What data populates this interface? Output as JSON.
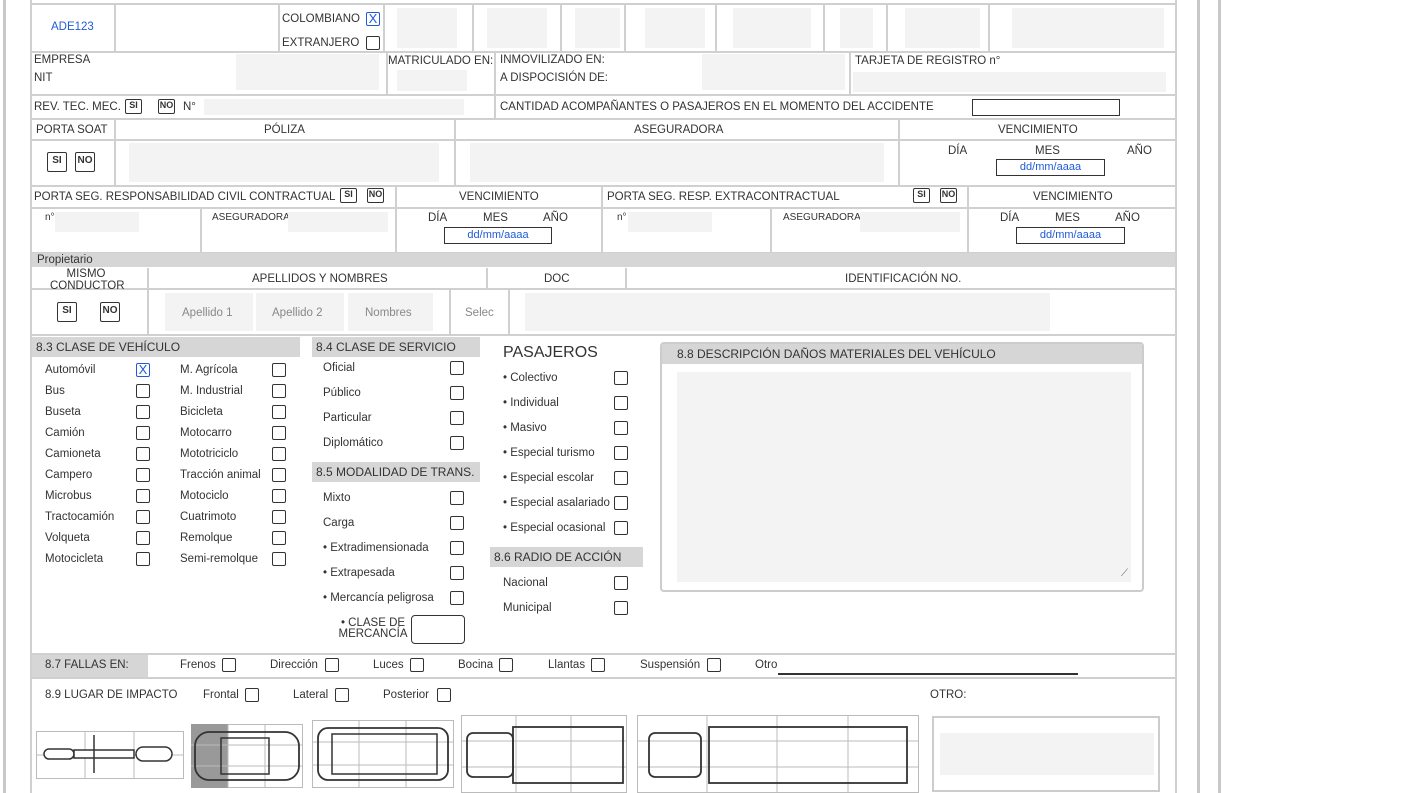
{
  "vehicle": {
    "plate": "ADE123",
    "colombiano": "COLOMBIANO",
    "extranjero": "EXTRANJERO",
    "mark": "X"
  },
  "row2": {
    "empresa": "EMPRESA",
    "nit": "NIT",
    "matriculado": "MATRICULADO EN:",
    "inmovilizado": "INMOVILIZADO EN:",
    "disposicion": "A DISPOCISIÓN DE:",
    "tarjeta": "TARJETA DE REGISTRO n°"
  },
  "row3": {
    "revtec": "REV. TEC. MEC.",
    "si": "SI",
    "no": "NO",
    "num": "N°",
    "acomp": "CANTIDAD ACOMPAÑANTES O PASAJEROS EN EL MOMENTO DEL ACCIDENTE"
  },
  "soat": {
    "porta": "PORTA SOAT",
    "poliza": "PÓLIZA",
    "aseguradora": "ASEGURADORA",
    "vencimiento": "VENCIMIENTO",
    "dia": "DÍA",
    "mes": "MES",
    "anio": "AÑO",
    "date_placeholder": "dd/mm/aaaa"
  },
  "rc": {
    "contractual": "PORTA SEG. RESPONSABILIDAD CIVIL CONTRACTUAL",
    "vencimiento": "VENCIMIENTO",
    "extra": "PORTA SEG. RESP. EXTRACONTRACTUAL",
    "n": "n°",
    "aseguradora": "ASEGURADORA"
  },
  "owner": {
    "title": "Propietario",
    "mismo": "MISMO CONDUCTOR",
    "apellidos": "APELLIDOS Y NOMBRES",
    "doc": "DOC",
    "ident": "IDENTIFICACIÓN NO.",
    "ap1": "Apellido 1",
    "ap2": "Apellido 2",
    "nombres": "Nombres",
    "select": "Selec"
  },
  "clase": {
    "title": "8.3 CLASE DE VEHÍCULO",
    "col1": [
      "Automóvil",
      "Bus",
      "Buseta",
      "Camión",
      "Camioneta",
      "Campero",
      "Microbus",
      "Tractocamión",
      "Volqueta",
      "Motocicleta"
    ],
    "col2": [
      "M. Agrícola",
      "M. Industrial",
      "Bicicleta",
      "Motocarro",
      "Mototriciclo",
      "Tracción animal",
      "Motociclo",
      "Cuatrimoto",
      "Remolque",
      "Semi-remolque"
    ],
    "checked_mark": "X"
  },
  "servicio": {
    "title": "8.4 CLASE DE SERVICIO",
    "items": [
      "Oficial",
      "Público",
      "Particular",
      "Diplomático"
    ]
  },
  "modalidad": {
    "title": "8.5 MODALIDAD DE TRANS.",
    "items": [
      "Mixto",
      "Carga",
      "• Extradimensionada",
      "• Extrapesada",
      "• Mercancía peligrosa"
    ],
    "clase_merc": "• CLASE DE MERCANCÍA"
  },
  "pasajeros": {
    "title": "PASAJEROS",
    "items": [
      "• Colectivo",
      "• Individual",
      "• Masivo",
      "• Especial turismo",
      "• Especial escolar",
      "• Especial asalariado",
      "• Especial ocasional"
    ]
  },
  "radio": {
    "title": "8.6 RADIO DE ACCIÓN",
    "items": [
      "Nacional",
      "Municipal"
    ]
  },
  "danos": {
    "title": "8.8 DESCRIPCIÓN DAÑOS MATERIALES DEL VEHÍCULO"
  },
  "fallas": {
    "title": "8.7 FALLAS EN:",
    "items": [
      "Frenos",
      "Dirección",
      "Luces",
      "Bocina",
      "Llantas",
      "Suspensión"
    ],
    "otro": "Otro"
  },
  "impacto": {
    "title": "8.9 LUGAR DE IMPACTO",
    "items": [
      "Frontal",
      "Lateral",
      "Posterior"
    ],
    "otro": "OTRO:"
  }
}
